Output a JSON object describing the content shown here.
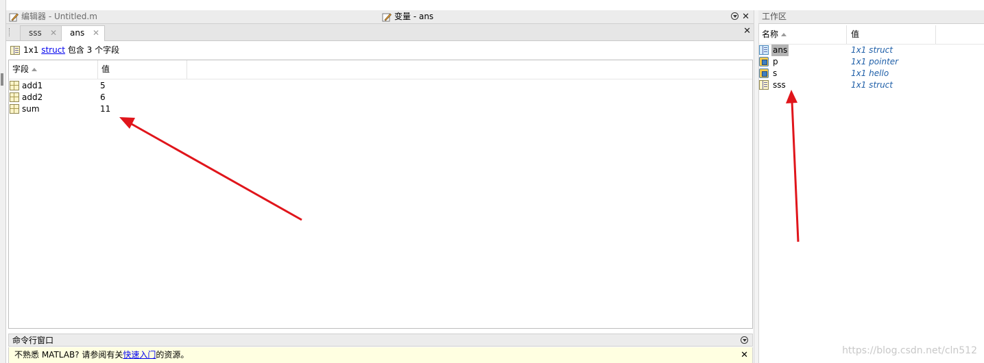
{
  "editor": {
    "title": "编辑器 - Untitled.m"
  },
  "variables": {
    "title": "变量 - ans",
    "tabs": [
      {
        "label": "sss",
        "active": false
      },
      {
        "label": "ans",
        "active": true
      }
    ],
    "info": {
      "size": "1x1",
      "class_link": "struct",
      "suffix": "包含 3 个字段"
    },
    "columns": {
      "field": "字段",
      "value": "值"
    },
    "rows": [
      {
        "field": "add1",
        "value": "5"
      },
      {
        "field": "add2",
        "value": "6"
      },
      {
        "field": "sum",
        "value": "11"
      }
    ]
  },
  "command_window": {
    "title": "命令行窗口",
    "message_prefix": "不熟悉 MATLAB? 请参阅有关",
    "message_link": "快速入门",
    "message_suffix": "的资源。"
  },
  "workspace": {
    "title": "工作区",
    "columns": {
      "name": "名称",
      "value": "值"
    },
    "rows": [
      {
        "name": "ans",
        "value": "1x1 struct",
        "icon": "struct-icon",
        "selected": true
      },
      {
        "name": "p",
        "value": "1x1 pointer",
        "icon": "object-icon",
        "selected": false
      },
      {
        "name": "s",
        "value": "1x1 hello",
        "icon": "object-icon",
        "selected": false
      },
      {
        "name": "sss",
        "value": "1x1 struct",
        "icon": "struct-icon",
        "selected": false
      }
    ]
  },
  "watermark": "https://blog.csdn.net/cln512",
  "colors": {
    "annotation_arrow": "#e0151b",
    "link": "#0000ee",
    "workspace_value": "#1f5fa8",
    "message_bg": "#ffffe1"
  }
}
